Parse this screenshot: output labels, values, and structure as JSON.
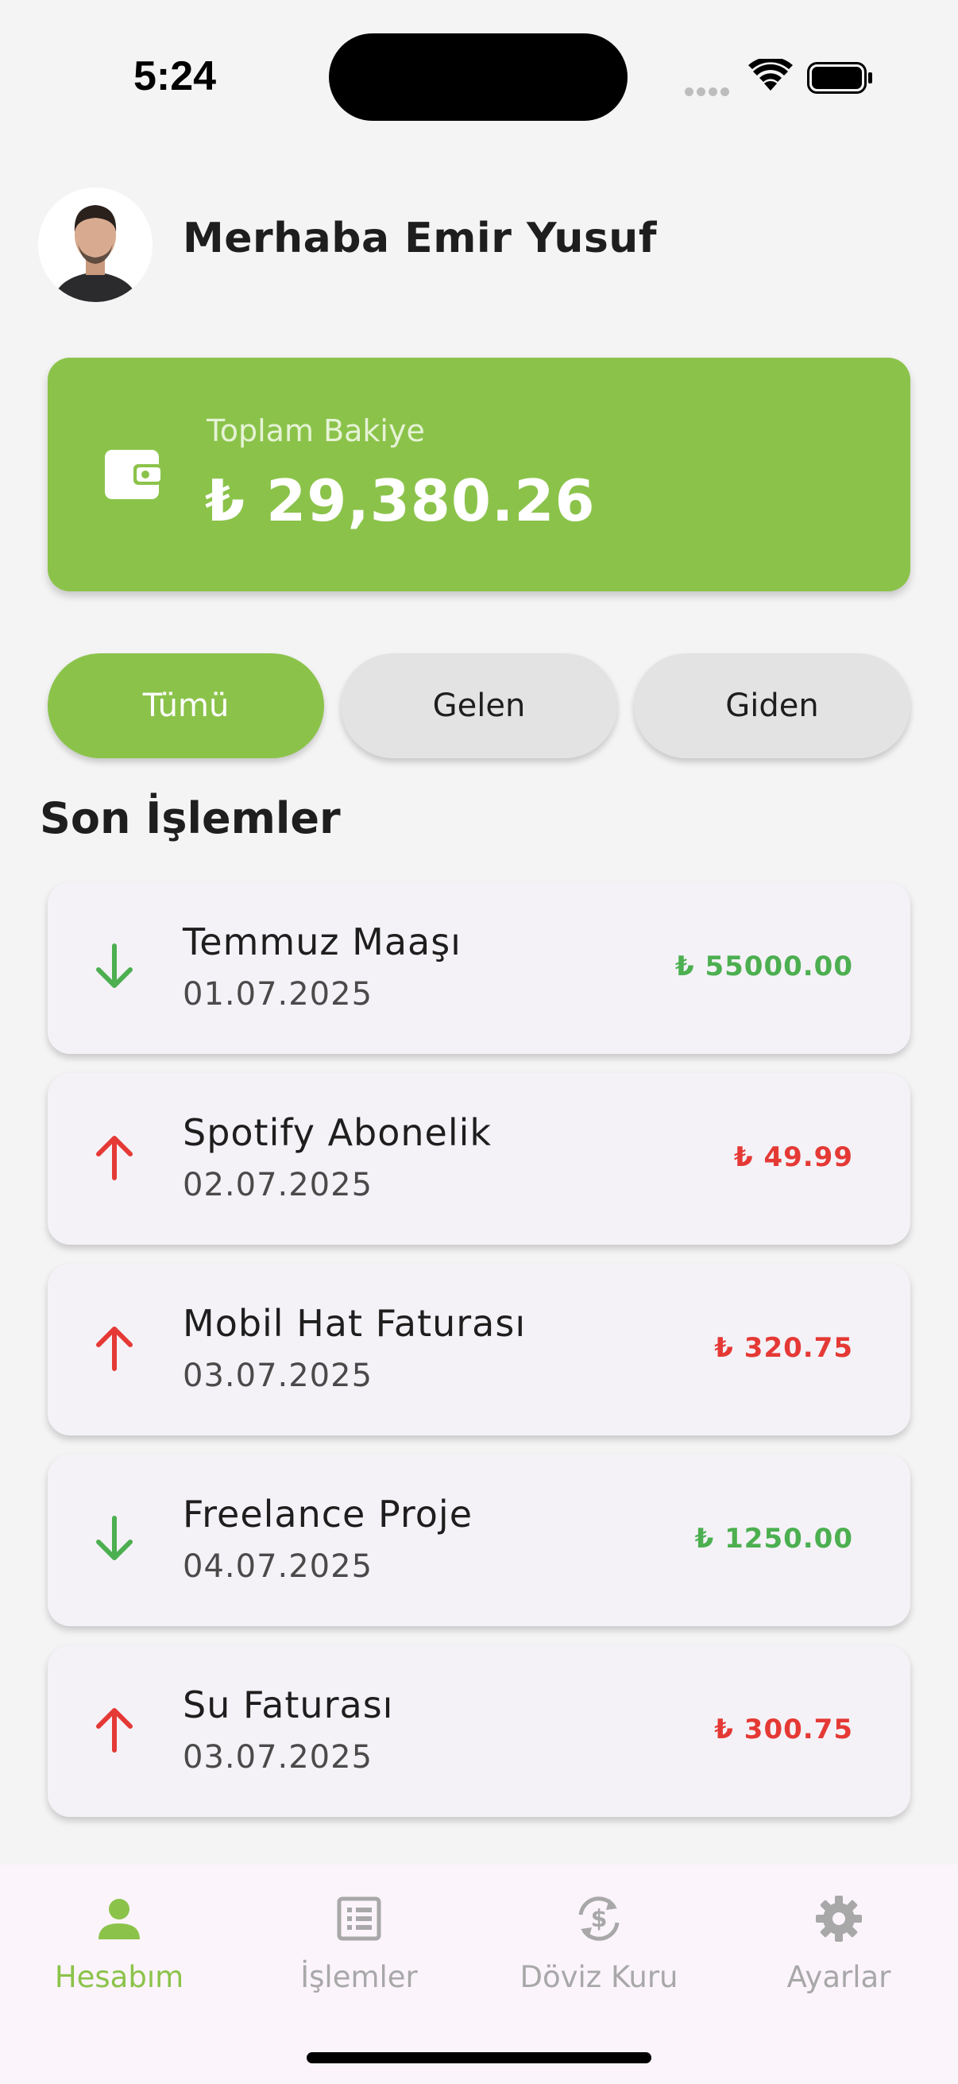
{
  "status_bar": {
    "time": "5:24"
  },
  "header": {
    "greeting": "Merhaba Emir Yusuf"
  },
  "balance": {
    "label": "Toplam Bakiye",
    "value": "₺ 29,380.26"
  },
  "filters": {
    "all": "Tümü",
    "incoming": "Gelen",
    "outgoing": "Giden",
    "selected": "Tümü"
  },
  "section_title": "Son İşlemler",
  "transactions": [
    {
      "title": "Temmuz Maaşı",
      "date": "01.07.2025",
      "amount": "₺ 55000.00",
      "direction": "in"
    },
    {
      "title": "Spotify Abonelik",
      "date": "02.07.2025",
      "amount": "₺ 49.99",
      "direction": "out"
    },
    {
      "title": "Mobil Hat Faturası",
      "date": "03.07.2025",
      "amount": "₺ 320.75",
      "direction": "out"
    },
    {
      "title": "Freelance Proje",
      "date": "04.07.2025",
      "amount": "₺ 1250.00",
      "direction": "in"
    },
    {
      "title": "Su Faturası",
      "date": "03.07.2025",
      "amount": "₺ 300.75",
      "direction": "out"
    }
  ],
  "nav": [
    {
      "label": "Hesabım",
      "icon": "person-icon",
      "active": true
    },
    {
      "label": "İşlemler",
      "icon": "list-icon",
      "active": false
    },
    {
      "label": "Döviz Kuru",
      "icon": "currency-exchange-icon",
      "active": false
    },
    {
      "label": "Ayarlar",
      "icon": "gear-icon",
      "active": false
    }
  ],
  "colors": {
    "accent": "#8bc34a",
    "income": "#4caf50",
    "expense": "#e53935",
    "inactive": "#a8a8a8"
  }
}
